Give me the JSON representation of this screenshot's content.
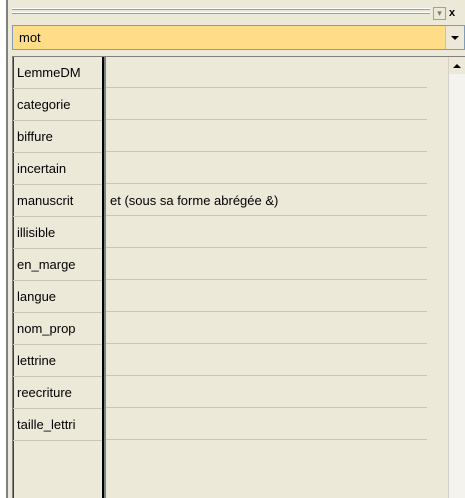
{
  "window": {
    "close_glyph": "x",
    "dropdown_glyph": "▾"
  },
  "selector": {
    "value": "mot",
    "background": "#ffdd88"
  },
  "properties": [
    {
      "name": "LemmeDM",
      "value": ""
    },
    {
      "name": "categorie",
      "value": ""
    },
    {
      "name": "biffure",
      "value": ""
    },
    {
      "name": "incertain",
      "value": ""
    },
    {
      "name": "manuscrit",
      "value": "et (sous sa forme abrégée &)"
    },
    {
      "name": "illisible",
      "value": ""
    },
    {
      "name": "en_marge",
      "value": ""
    },
    {
      "name": "langue",
      "value": ""
    },
    {
      "name": "nom_prop",
      "value": ""
    },
    {
      "name": "lettrine",
      "value": ""
    },
    {
      "name": "reecriture",
      "value": ""
    },
    {
      "name": "taille_lettri",
      "value": ""
    }
  ]
}
